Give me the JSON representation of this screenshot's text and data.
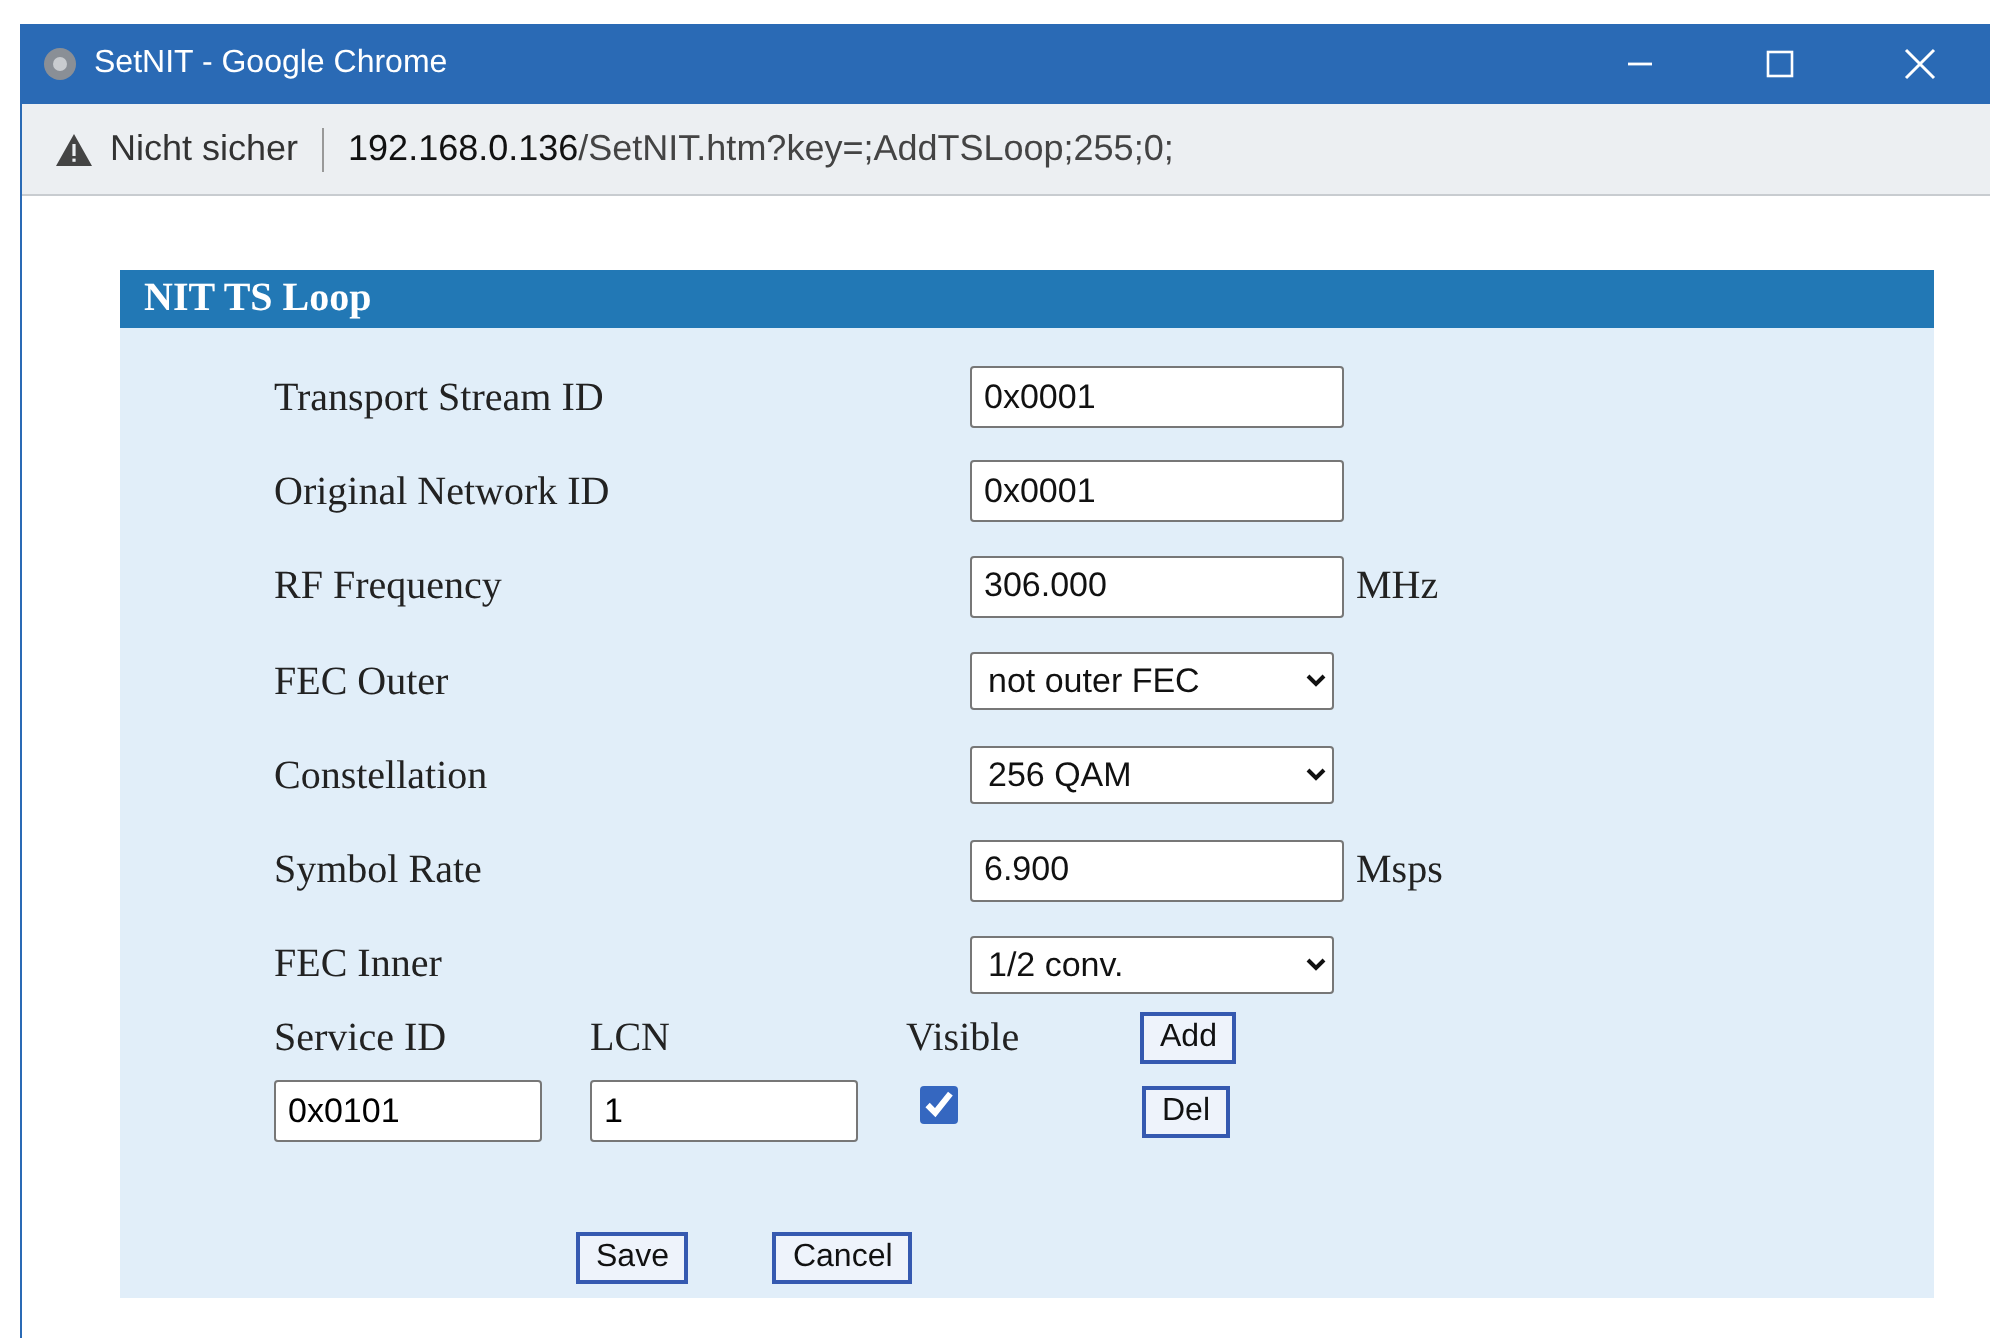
{
  "window": {
    "title": "SetNIT - Google Chrome"
  },
  "address_bar": {
    "security": "Nicht sicher",
    "host": "192.168.0.136",
    "path": "/SetNIT.htm?key=;AddTSLoop;255;0;"
  },
  "panel": {
    "title": "NIT TS Loop",
    "fields": [
      {
        "kind": "text",
        "label": "Transport Stream ID",
        "value": "0x0001"
      },
      {
        "kind": "text",
        "label": "Original Network ID",
        "value": "0x0001"
      },
      {
        "kind": "text",
        "label": "RF Frequency",
        "value": "306.000",
        "unit": "MHz"
      },
      {
        "kind": "select",
        "label": "FEC Outer",
        "value": "not outer FEC"
      },
      {
        "kind": "select",
        "label": "Constellation",
        "value": "256 QAM"
      },
      {
        "kind": "text",
        "label": "Symbol Rate",
        "value": "6.900",
        "unit": "Msps"
      },
      {
        "kind": "select",
        "label": "FEC Inner",
        "value": "1/2 conv."
      }
    ],
    "services": {
      "columns": [
        "Service ID",
        "LCN",
        "Visible"
      ],
      "add_button": "Add",
      "rows": [
        {
          "service_id": "0x0101",
          "lcn": "1",
          "visible": true,
          "del_button": "Del"
        }
      ]
    },
    "buttons": [
      "Save",
      "Cancel"
    ]
  }
}
